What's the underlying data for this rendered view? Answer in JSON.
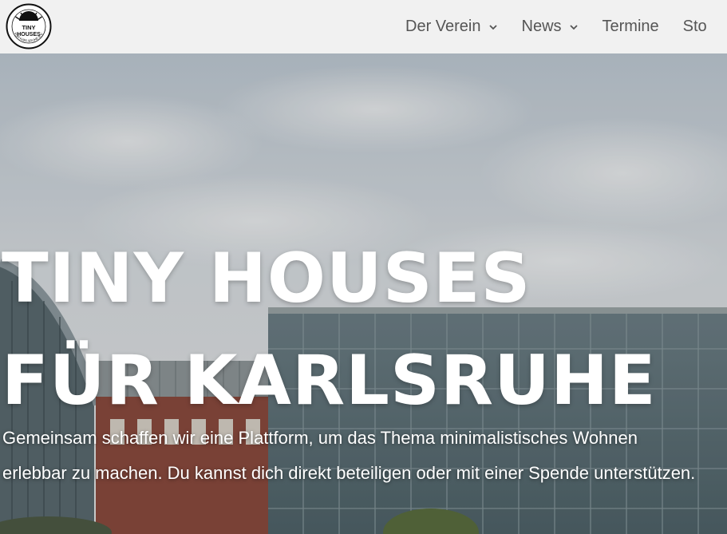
{
  "header": {
    "logo_line1": "TINY",
    "logo_line2": "HOUSES",
    "logo_ring": "FÜR KARLSRUHE E.V.",
    "nav": [
      {
        "label": "Der Verein",
        "has_dropdown": true
      },
      {
        "label": "News",
        "has_dropdown": true
      },
      {
        "label": "Termine",
        "has_dropdown": false
      },
      {
        "label": "Sto",
        "has_dropdown": false
      }
    ]
  },
  "hero": {
    "title_line1": "TINY HOUSES",
    "title_line2": "FÜR KARLSRUHE",
    "text": "Gemeinsam schaffen wir eine Plattform, um das Thema minimalistisches Wohnen erlebbar zu machen. Du kannst dich direkt beteiligen oder mit einer Spende unterstützen."
  },
  "colors": {
    "header_bg": "#f1f1f1",
    "nav_text": "#555555",
    "hero_text": "#ffffff"
  }
}
